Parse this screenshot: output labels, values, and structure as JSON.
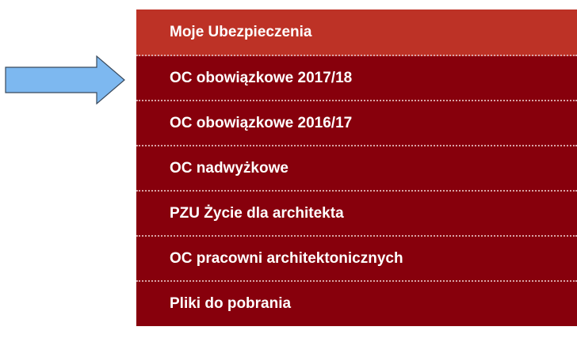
{
  "colors": {
    "menu_background": "#87000c",
    "menu_active_background": "#bd3226",
    "menu_text": "#ffffff",
    "arrow_fill": "#7db8f0",
    "arrow_stroke": "#3a4a5c"
  },
  "pointer": {
    "icon": "right-arrow-icon"
  },
  "menu": {
    "items": [
      {
        "label": "Moje Ubezpieczenia",
        "active": true
      },
      {
        "label": "OC obowiązkowe 2017/18",
        "active": false
      },
      {
        "label": "OC obowiązkowe 2016/17",
        "active": false
      },
      {
        "label": "OC nadwyżkowe",
        "active": false
      },
      {
        "label": "PZU Życie dla architekta",
        "active": false
      },
      {
        "label": "OC pracowni architektonicznych",
        "active": false
      },
      {
        "label": "Pliki do pobrania",
        "active": false
      }
    ]
  }
}
